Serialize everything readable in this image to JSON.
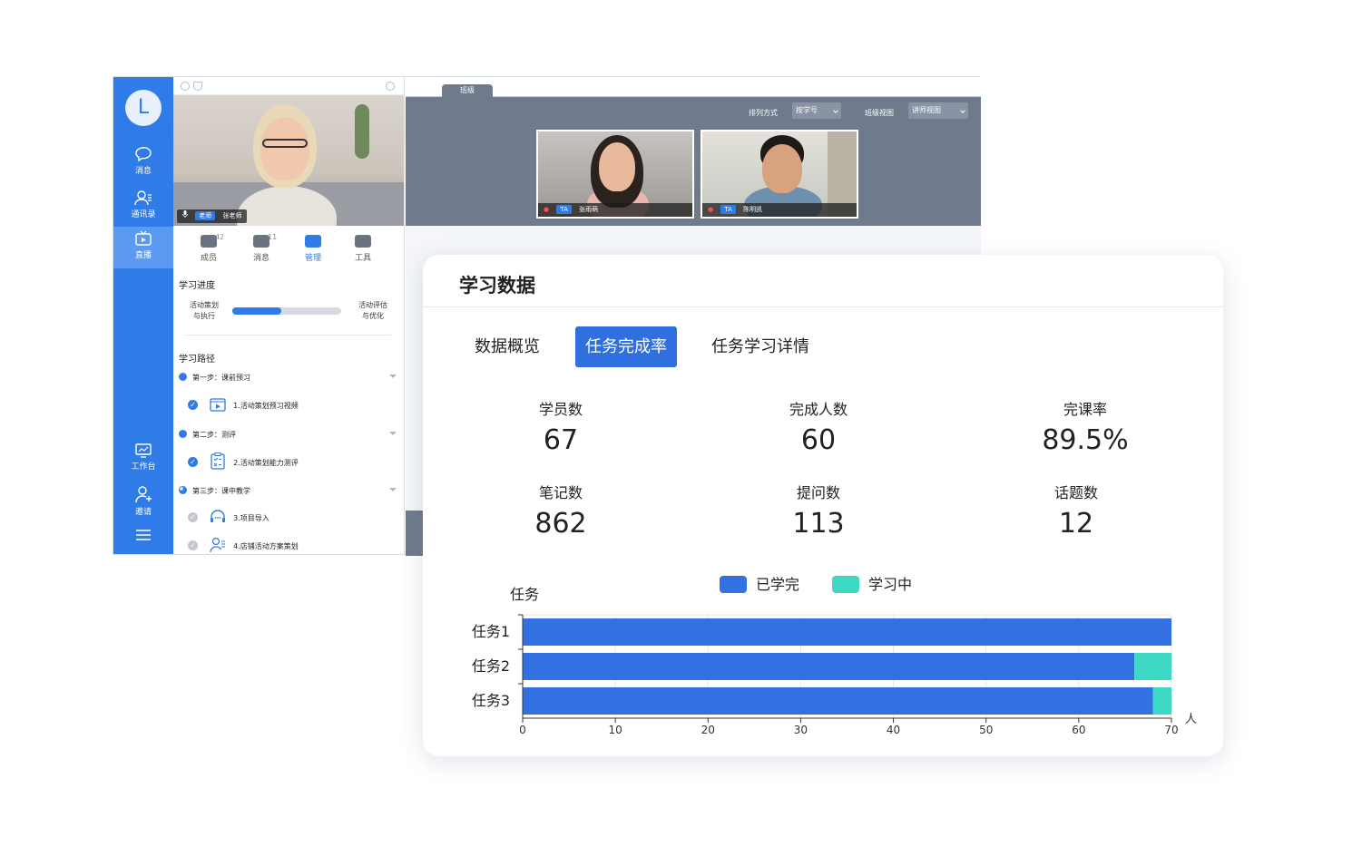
{
  "app": {
    "rail": {
      "avatar_letter": "L",
      "items": [
        {
          "label": "消息",
          "icon": "chat-bubble-icon"
        },
        {
          "label": "通讯录",
          "icon": "contacts-icon"
        },
        {
          "label": "直播",
          "icon": "live-tv-icon",
          "active": true
        },
        {
          "label": "工作台",
          "icon": "workbench-icon"
        },
        {
          "label": "邀请",
          "icon": "invite-user-icon"
        }
      ],
      "menu_icon": "hamburger-menu-icon"
    },
    "teacher": {
      "role": "老师",
      "name": "张老师"
    },
    "side_tabs": [
      {
        "label": "成员",
        "count": "42",
        "icon": "members-icon"
      },
      {
        "label": "消息",
        "count": "11",
        "icon": "messages-icon"
      },
      {
        "label": "管理",
        "count": "",
        "icon": "manage-icon",
        "active": true
      },
      {
        "label": "工具",
        "count": "",
        "icon": "toolbox-icon"
      }
    ],
    "progress": {
      "title": "学习进度",
      "left_label_1": "活动策划",
      "left_label_2": "与执行",
      "right_label_1": "活动评估",
      "right_label_2": "与优化",
      "value": 0.45
    },
    "path": {
      "title": "学习路径",
      "steps": [
        {
          "label": "第一步：课前预习",
          "task": "1.活动策划预习视频",
          "task_icon": "video-icon",
          "done": true
        },
        {
          "label": "第二步：测评",
          "task": "2.活动策划能力测评",
          "task_icon": "quiz-clipboard-icon",
          "done": true
        },
        {
          "label": "第三步：课中教学",
          "tasks": [
            {
              "label": "3.项目导入",
              "icon": "headset-icon",
              "done": false
            },
            {
              "label": "4.店铺活动方案策划",
              "icon": "user-list-icon",
              "done": false
            }
          ]
        }
      ]
    },
    "main": {
      "tab": "班级",
      "sort_label": "排列方式",
      "sort_value": "按学号",
      "view_label": "班级视图",
      "view_value": "讲师视图",
      "students": [
        {
          "role": "TA",
          "name": "张雨萌"
        },
        {
          "role": "TA",
          "name": "陈明凯"
        }
      ]
    }
  },
  "card": {
    "title": "学习数据",
    "tabs": [
      "数据概览",
      "任务完成率",
      "任务学习详情"
    ],
    "active_tab": 1,
    "stats": [
      {
        "label": "学员数",
        "value": "67"
      },
      {
        "label": "完成人数",
        "value": "60"
      },
      {
        "label": "完课率",
        "value": "89.5%"
      },
      {
        "label": "笔记数",
        "value": "862"
      },
      {
        "label": "提问数",
        "value": "113"
      },
      {
        "label": "话题数",
        "value": "12"
      }
    ]
  },
  "chart_data": {
    "type": "bar",
    "orientation": "horizontal",
    "stacked": true,
    "ylabel": "任务",
    "xlabel": "人",
    "categories": [
      "任务1",
      "任务2",
      "任务3"
    ],
    "series": [
      {
        "name": "已学完",
        "values": [
          70,
          66,
          68
        ],
        "color": "#3371e2"
      },
      {
        "name": "学习中",
        "values": [
          0,
          4,
          2
        ],
        "color": "#3dd9c5"
      }
    ],
    "xlim": [
      0,
      70
    ],
    "xticks": [
      0,
      10,
      20,
      30,
      40,
      50,
      60,
      70
    ],
    "grid": true,
    "legend": "top-center"
  }
}
